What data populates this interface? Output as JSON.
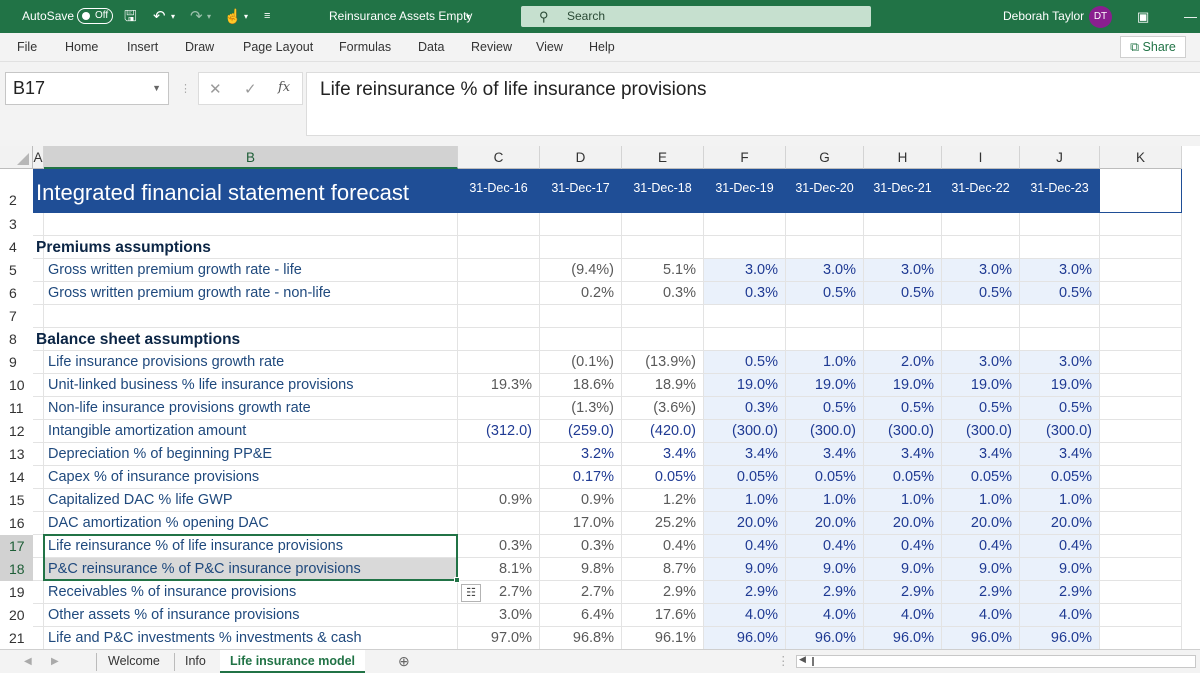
{
  "titlebar": {
    "autosave_label": "AutoSave",
    "autosave_state": "Off",
    "doc_title": "Reinsurance Assets Empty",
    "search_placeholder": "Search",
    "user_name": "Deborah Taylor",
    "user_initials": "DT"
  },
  "ribbon": {
    "tabs": [
      "File",
      "Home",
      "Insert",
      "Draw",
      "Page Layout",
      "Formulas",
      "Data",
      "Review",
      "View",
      "Help"
    ],
    "share_label": "Share"
  },
  "formula_bar": {
    "name_box": "B17",
    "fx_label": "fx",
    "content": "Life reinsurance % of life insurance provisions"
  },
  "columns": [
    "A",
    "B",
    "C",
    "D",
    "E",
    "F",
    "G",
    "H",
    "I",
    "J",
    "K"
  ],
  "band": {
    "row": "2",
    "title": "Integrated financial statement forecast",
    "dates": [
      "31-Dec-16",
      "31-Dec-17",
      "31-Dec-18",
      "31-Dec-19",
      "31-Dec-20",
      "31-Dec-21",
      "31-Dec-22",
      "31-Dec-23"
    ]
  },
  "rows": [
    {
      "num": "3",
      "label": "",
      "values": [
        "",
        "",
        "",
        "",
        "",
        "",
        "",
        ""
      ]
    },
    {
      "num": "4",
      "label": "Premiums assumptions",
      "header": true,
      "values": [
        "",
        "",
        "",
        "",
        "",
        "",
        "",
        ""
      ]
    },
    {
      "num": "5",
      "label": "Gross written premium growth rate - life",
      "values": [
        "",
        "(9.4%)",
        "5.1%",
        "3.0%",
        "3.0%",
        "3.0%",
        "3.0%",
        "3.0%"
      ]
    },
    {
      "num": "6",
      "label": "Gross written premium growth rate - non-life",
      "values": [
        "",
        "0.2%",
        "0.3%",
        "0.3%",
        "0.5%",
        "0.5%",
        "0.5%",
        "0.5%"
      ]
    },
    {
      "num": "7",
      "label": "",
      "values": [
        "",
        "",
        "",
        "",
        "",
        "",
        "",
        ""
      ]
    },
    {
      "num": "8",
      "label": "Balance sheet assumptions",
      "header": true,
      "values": [
        "",
        "",
        "",
        "",
        "",
        "",
        "",
        ""
      ]
    },
    {
      "num": "9",
      "label": "Life insurance provisions growth rate",
      "values": [
        "",
        "(0.1%)",
        "(13.9%)",
        "0.5%",
        "1.0%",
        "2.0%",
        "3.0%",
        "3.0%"
      ]
    },
    {
      "num": "10",
      "label": "Unit-linked business % life insurance provisions",
      "values": [
        "19.3%",
        "18.6%",
        "18.9%",
        "19.0%",
        "19.0%",
        "19.0%",
        "19.0%",
        "19.0%"
      ]
    },
    {
      "num": "11",
      "label": "Non-life insurance provisions growth rate",
      "values": [
        "",
        "(1.3%)",
        "(3.6%)",
        "0.3%",
        "0.5%",
        "0.5%",
        "0.5%",
        "0.5%"
      ]
    },
    {
      "num": "12",
      "label": "Intangible amortization amount",
      "blue": true,
      "values": [
        "(312.0)",
        "(259.0)",
        "(420.0)",
        "(300.0)",
        "(300.0)",
        "(300.0)",
        "(300.0)",
        "(300.0)"
      ]
    },
    {
      "num": "13",
      "label": "Depreciation % of beginning PP&E",
      "blue": true,
      "values": [
        "",
        "3.2%",
        "3.4%",
        "3.4%",
        "3.4%",
        "3.4%",
        "3.4%",
        "3.4%"
      ]
    },
    {
      "num": "14",
      "label": "Capex % of insurance provisions",
      "blue": true,
      "values": [
        "",
        "0.17%",
        "0.05%",
        "0.05%",
        "0.05%",
        "0.05%",
        "0.05%",
        "0.05%"
      ]
    },
    {
      "num": "15",
      "label": "Capitalized DAC % life GWP",
      "values": [
        "0.9%",
        "0.9%",
        "1.2%",
        "1.0%",
        "1.0%",
        "1.0%",
        "1.0%",
        "1.0%"
      ]
    },
    {
      "num": "16",
      "label": "DAC amortization % opening DAC",
      "values": [
        "",
        "17.0%",
        "25.2%",
        "20.0%",
        "20.0%",
        "20.0%",
        "20.0%",
        "20.0%"
      ]
    },
    {
      "num": "17",
      "label": "Life reinsurance % of life insurance provisions",
      "values": [
        "0.3%",
        "0.3%",
        "0.4%",
        "0.4%",
        "0.4%",
        "0.4%",
        "0.4%",
        "0.4%"
      ]
    },
    {
      "num": "18",
      "label": "P&C reinsurance % of P&C insurance provisions",
      "values": [
        "8.1%",
        "9.8%",
        "8.7%",
        "9.0%",
        "9.0%",
        "9.0%",
        "9.0%",
        "9.0%"
      ]
    },
    {
      "num": "19",
      "label": "Receivables % of insurance provisions",
      "values": [
        "2.7%",
        "2.7%",
        "2.9%",
        "2.9%",
        "2.9%",
        "2.9%",
        "2.9%",
        "2.9%"
      ]
    },
    {
      "num": "20",
      "label": "Other assets % of insurance provisions",
      "values": [
        "3.0%",
        "6.4%",
        "17.6%",
        "4.0%",
        "4.0%",
        "4.0%",
        "4.0%",
        "4.0%"
      ]
    },
    {
      "num": "21",
      "label": "Life and P&C investments % investments & cash",
      "values": [
        "97.0%",
        "96.8%",
        "96.1%",
        "96.0%",
        "96.0%",
        "96.0%",
        "96.0%",
        "96.0%"
      ]
    }
  ],
  "sheet_tabs": [
    "Welcome",
    "Info",
    "Life insurance model"
  ],
  "active_sheet": "Life insurance model",
  "colors": {
    "accent": "#217346",
    "band": "#1f4e96",
    "forecast_fill": "#eaf1fb",
    "label_text": "#1f497d"
  }
}
